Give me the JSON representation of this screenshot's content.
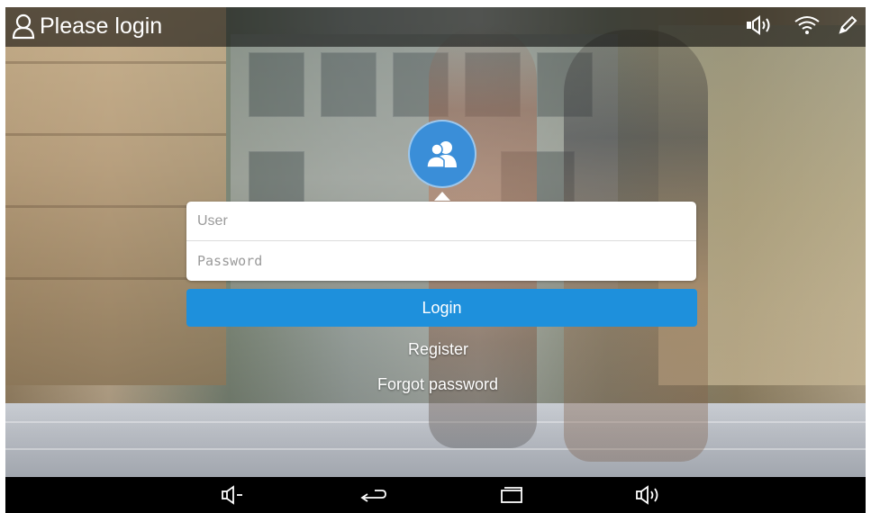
{
  "statusbar": {
    "title": "Please login",
    "icons": [
      "user-outline-icon",
      "volume-icon",
      "wifi-icon",
      "pen-icon"
    ]
  },
  "login": {
    "avatar_icon": "users-icon",
    "user_placeholder": "User",
    "password_placeholder": "Password",
    "login_label": "Login",
    "register_label": "Register",
    "forgot_label": "Forgot password"
  },
  "navbar": {
    "icons": [
      "volume-down-icon",
      "back-icon",
      "recent-apps-icon",
      "volume-up-icon"
    ]
  },
  "colors": {
    "accent": "#1e90dc",
    "avatar": "#3a8ed8",
    "statusbar": "#000000",
    "navbar": "#000000"
  }
}
